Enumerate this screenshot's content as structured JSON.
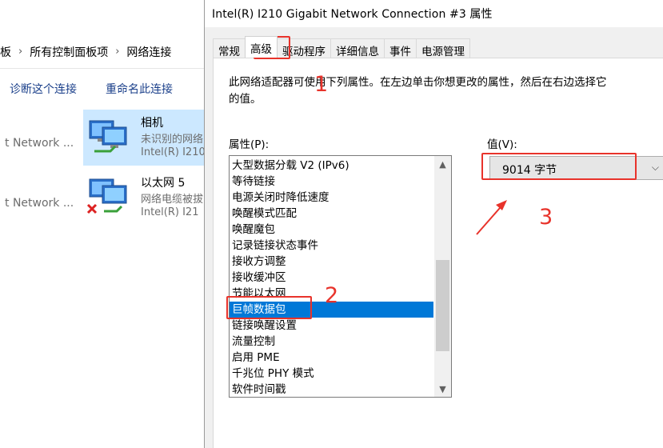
{
  "explorer": {
    "breadcrumb": [
      "板",
      "所有控制面板项",
      "网络连接"
    ],
    "commands": [
      "诊断这个连接",
      "重命名此连接"
    ],
    "adapters": [
      {
        "name": "相机",
        "status": "未识别的网络",
        "device": "Intel(R) I210",
        "left_device": "t Network ..."
      },
      {
        "name": "以太网 5",
        "status": "网络电缆被拔",
        "device": "Intel(R) I21",
        "left_device": "t Network ..."
      }
    ]
  },
  "dialog": {
    "title": "Intel(R) I210 Gigabit Network Connection #3 属性",
    "tabs": [
      "常规",
      "高级",
      "驱动程序",
      "详细信息",
      "事件",
      "电源管理"
    ],
    "active_tab": "高级",
    "description": "此网络适配器可使用下列属性。在左边单击你想更改的属性，然后在右边选择它的值。",
    "property_label": "属性(P):",
    "value_label": "值(V):",
    "properties": [
      "大型数据分载 V2 (IPv6)",
      "等待链接",
      "电源关闭时降低速度",
      "唤醒模式匹配",
      "唤醒魔包",
      "记录链接状态事件",
      "接收方调整",
      "接收缓冲区",
      "节能以太网",
      "巨帧数据包",
      "链接唤醒设置",
      "流量控制",
      "启用 PME",
      "千兆位 PHY 模式",
      "软件时间戳"
    ],
    "selected_property": "巨帧数据包",
    "value": "9014 字节"
  },
  "annotations": {
    "step1": "1",
    "step2": "2",
    "step3": "3",
    "color": "#e8332b"
  }
}
